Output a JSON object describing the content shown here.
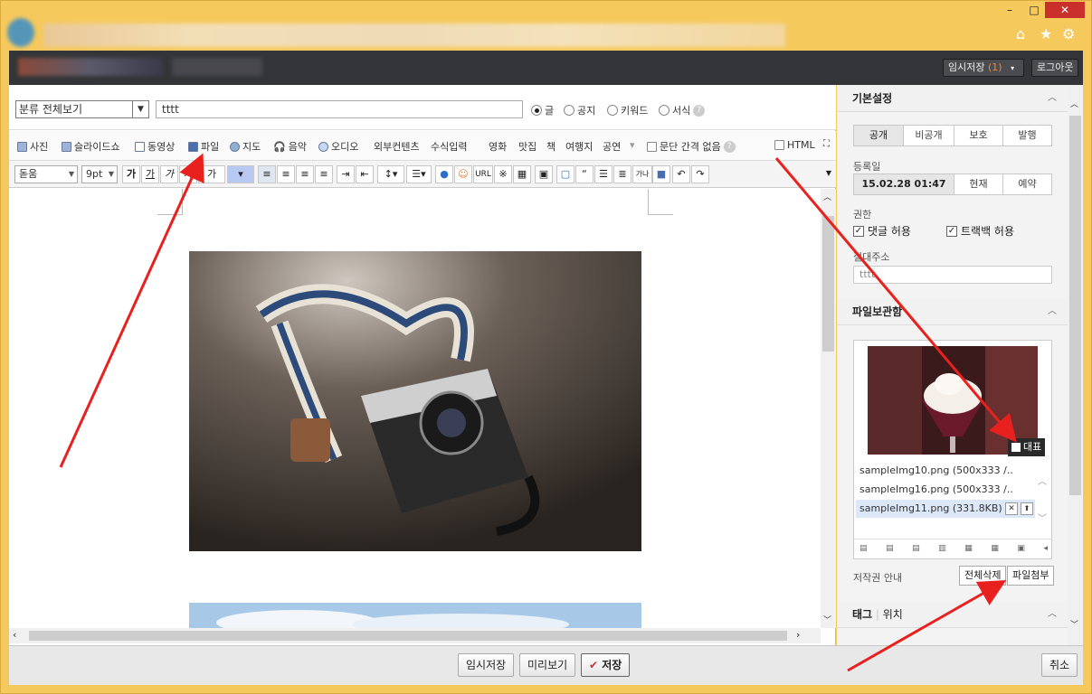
{
  "window": {
    "minimize": "–",
    "maximize": "□",
    "close": "✕"
  },
  "browser_icons": {
    "home": "⌂",
    "star": "★",
    "gear": "⚙"
  },
  "header": {
    "temp_save_label": "임시저장",
    "temp_save_count": "(1)",
    "logout": "로그아웃"
  },
  "row1": {
    "category": "분류 전체보기",
    "title_value": "tttt",
    "radios": [
      {
        "label": "글",
        "checked": true
      },
      {
        "label": "공지",
        "checked": false
      },
      {
        "label": "키워드",
        "checked": false
      },
      {
        "label": "서식",
        "checked": false
      }
    ]
  },
  "row2": {
    "items": [
      "사진",
      "슬라이드쇼",
      "동영상",
      "파일",
      "지도",
      "음악",
      "오디오",
      "외부컨텐츠",
      "수식입력"
    ],
    "items2": [
      "영화",
      "맛집",
      "책",
      "여행지",
      "공연"
    ],
    "paragraph": "문단 간격 없음",
    "html": "HTML"
  },
  "row3": {
    "font": "돋움",
    "size": "9pt",
    "bold": "가",
    "underline": "가",
    "italic": "가",
    "strike": "가",
    "color": "가",
    "url": "URL"
  },
  "bottom": {
    "temp_save": "임시저장",
    "preview": "미리보기",
    "save": "저장",
    "cancel": "취소"
  },
  "side": {
    "basic_title": "기본설정",
    "visibility": [
      "공개",
      "비공개",
      "보호",
      "발행"
    ],
    "regdate_label": "등록일",
    "regdate_value": "15.02.28 01:47",
    "now": "현재",
    "reserve": "예약",
    "perm_label": "권한",
    "allow_comment": "댓글 허용",
    "allow_trackback": "트랙백 허용",
    "alias_label": "절대주소",
    "alias_value": "tttt",
    "files_title": "파일보관함",
    "rep_label": "대표",
    "files": [
      "sampleImg10.png (500x333 /..",
      "sampleImg16.png (500x333 /..",
      "sampleImg11.png (331.8KB)"
    ],
    "copyright": "저작권 안내",
    "delete_all": "전체삭제",
    "attach": "파일첨부",
    "tag": "태그",
    "location": "위치"
  }
}
